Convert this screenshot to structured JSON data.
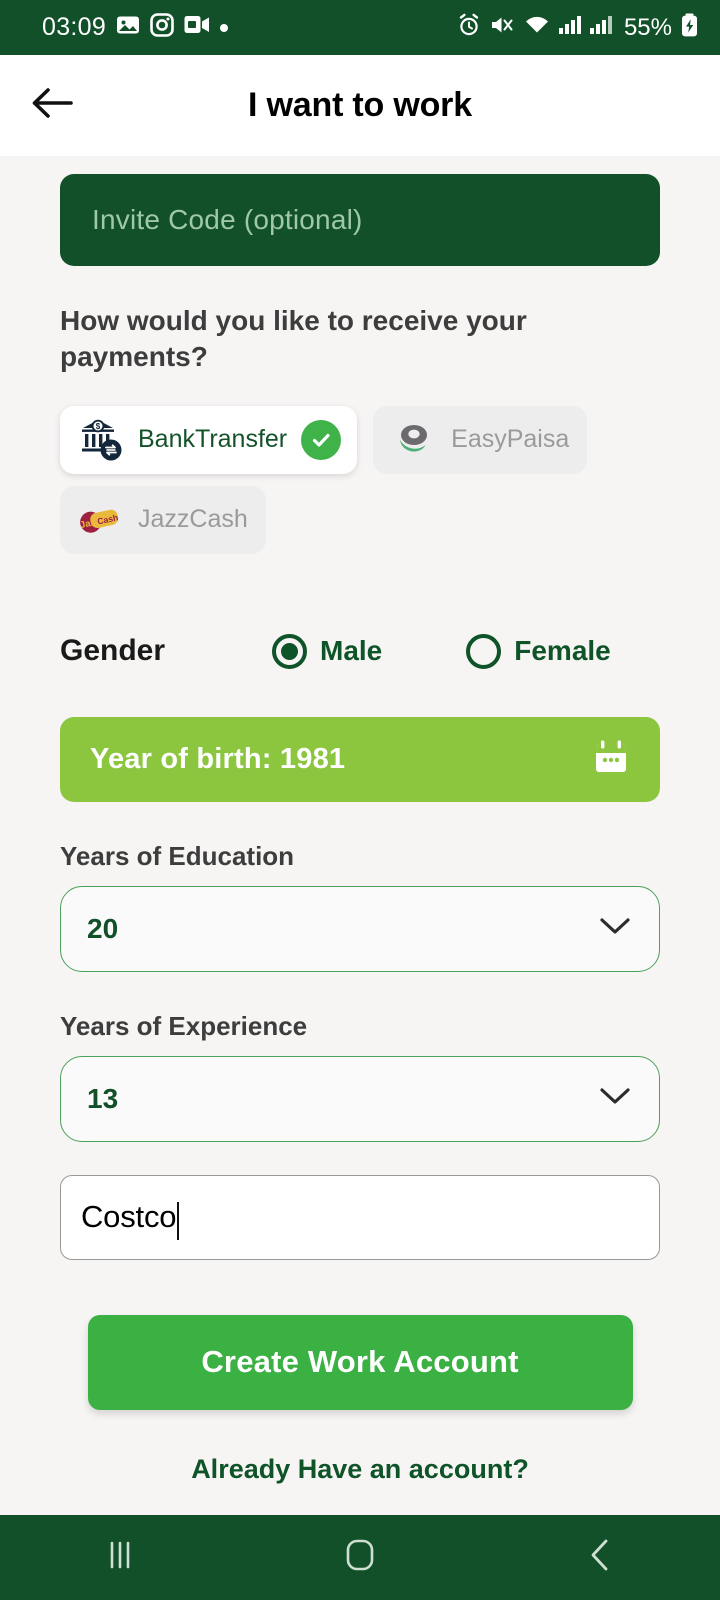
{
  "status_bar": {
    "time": "03:09",
    "battery_percent": "55%",
    "left_icons": [
      "photos-icon",
      "instagram-icon",
      "outlook-video-icon",
      "dot-icon"
    ],
    "right_icons": [
      "alarm-icon",
      "mute-icon",
      "wifi-icon",
      "signal-sim1-icon",
      "signal-sim2-icon",
      "battery-charging-icon"
    ]
  },
  "app_bar": {
    "back_icon": "back-arrow-icon",
    "title": "I want to work"
  },
  "form": {
    "invite_code": {
      "value": "",
      "placeholder": "Invite Code (optional)"
    },
    "payment_question": "How would you like to receive your payments?",
    "payment_methods": [
      {
        "label": "BankTransfer",
        "icon": "bank-transfer-icon",
        "selected": true
      },
      {
        "label": "EasyPaisa",
        "icon": "easypaisa-icon",
        "selected": false
      },
      {
        "label": "JazzCash",
        "icon": "jazzcash-icon",
        "selected": false
      }
    ],
    "gender": {
      "label": "Gender",
      "options": [
        {
          "label": "Male",
          "selected": true
        },
        {
          "label": "Female",
          "selected": false
        }
      ]
    },
    "year_of_birth": {
      "text": "Year of birth: 1981",
      "year": "1981",
      "icon": "calendar-icon"
    },
    "years_of_education": {
      "label": "Years of Education",
      "value": "20",
      "icon": "chevron-down-icon"
    },
    "years_of_experience": {
      "label": "Years of Experience",
      "value": "13",
      "icon": "chevron-down-icon"
    },
    "employer": {
      "value": "Costco",
      "placeholder": ""
    },
    "submit_label": "Create Work Account",
    "already_account_label": "Already Have an account?"
  },
  "nav_bar": {
    "recents_icon": "recents-icon",
    "home_icon": "home-icon",
    "back_icon": "nav-back-icon"
  },
  "colors": {
    "dark_green": "#12502a",
    "brand_green": "#3bb043",
    "lime_green": "#8cc63f",
    "page_bg": "#f7f5f4",
    "check_green": "#3fb24a"
  }
}
